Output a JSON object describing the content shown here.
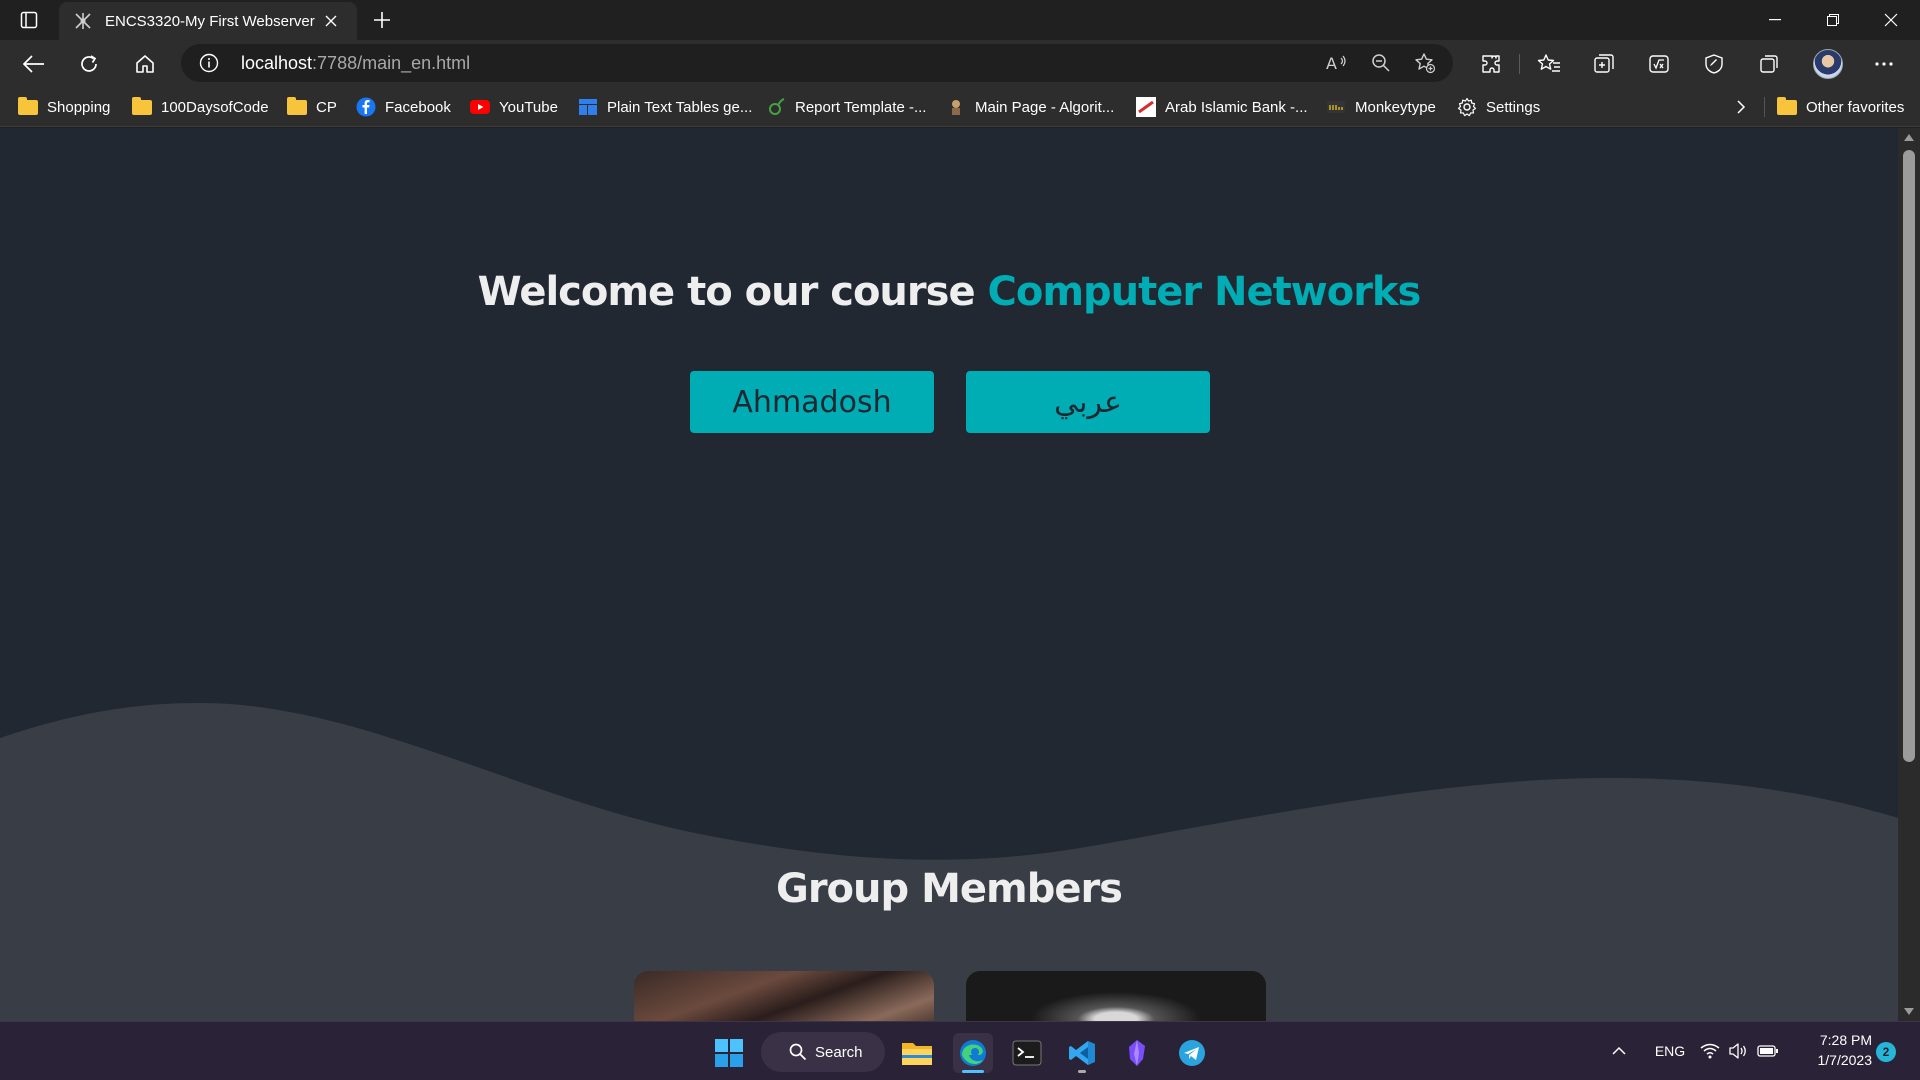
{
  "browser": {
    "tab_title": "ENCS3320-My First Webserver",
    "url_host": "localhost",
    "url_rest": ":7788/main_en.html"
  },
  "bookmarks": [
    {
      "label": "Shopping",
      "icon": "folder-icon"
    },
    {
      "label": "100DaysofCode",
      "icon": "folder-icon"
    },
    {
      "label": "CP",
      "icon": "folder-icon"
    },
    {
      "label": "Facebook",
      "icon": "facebook-icon"
    },
    {
      "label": "YouTube",
      "icon": "youtube-icon"
    },
    {
      "label": "Plain Text Tables ge...",
      "icon": "table-icon"
    },
    {
      "label": "Report Template -...",
      "icon": "overleaf-icon"
    },
    {
      "label": "Main Page - Algorit...",
      "icon": "algorithmica-icon"
    },
    {
      "label": "Arab Islamic Bank -...",
      "icon": "bank-icon"
    },
    {
      "label": "Monkeytype",
      "icon": "monkeytype-icon"
    },
    {
      "label": "Settings",
      "icon": "gear-icon"
    }
  ],
  "bookmarks_other": "Other favorites",
  "page": {
    "hero_prefix": "Welcome to our course",
    "hero_accent": "Computer Networks",
    "btn_primary": "Ahmadosh",
    "btn_arabic": "عربي",
    "section_title": "Group Members"
  },
  "colors": {
    "bg_dark": "#222831",
    "bg_wave": "#393e46",
    "accent": "#00adb5",
    "text": "#eeeeee"
  },
  "taskbar": {
    "search_label": "Search",
    "lang": "ENG",
    "time": "7:28 PM",
    "date": "1/7/2023",
    "notifications": "2"
  }
}
